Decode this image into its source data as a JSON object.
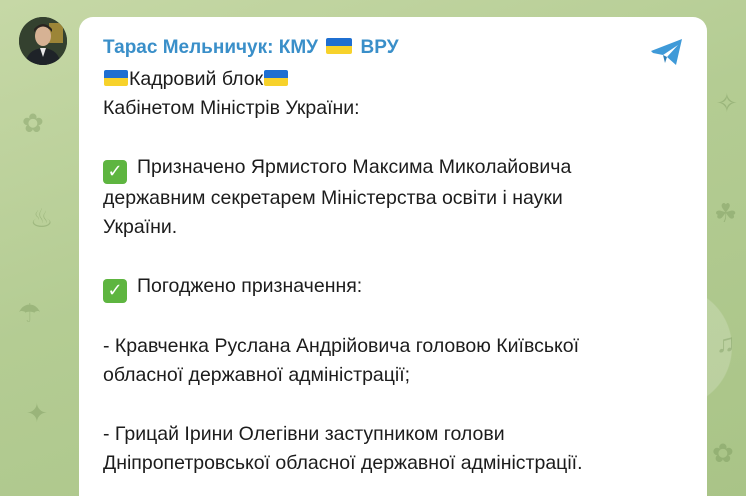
{
  "channel": {
    "sender_name": "Тарас Мельничук: КМУ",
    "sender_suffix": "ВРУ",
    "flag_icon": "ukraine-flag-icon",
    "share_icon": "telegram-share-icon"
  },
  "message": {
    "heading": "Кадровий блок",
    "subheading": "Кабінетом Міністрів України:",
    "item1": {
      "line1": "Призначено Ярмистого Максима Миколайовича",
      "line2": "державним секретарем Міністерства освіти і науки",
      "line3": "України."
    },
    "item2": {
      "line1": "Погоджено призначення:"
    },
    "entry1": {
      "line1": "- Кравченка Руслана Андрійовича головою Київської",
      "line2": "обласної державної адміністрації;"
    },
    "entry2": {
      "line1": "- Грицай Ірини Олегівни заступником голови",
      "line2": "Дніпропетровської обласної державної адміністрації."
    }
  },
  "colors": {
    "sender": "#3a8fc9",
    "background": "#b9cf9b",
    "check": "#5eb540",
    "flag_blue": "#1f6fd1",
    "flag_yellow": "#f7d22b"
  }
}
